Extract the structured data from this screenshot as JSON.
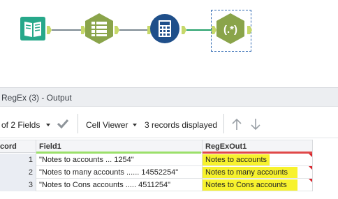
{
  "workflow": {
    "tools": [
      {
        "name": "input-data-tool",
        "icon": "book-icon"
      },
      {
        "name": "select-tool",
        "icon": "table-list-icon"
      },
      {
        "name": "formula-tool",
        "icon": "calculator-globe-icon"
      },
      {
        "name": "regex-tool",
        "icon": "regex-icon",
        "label": "(.*)"
      }
    ],
    "colors": {
      "connector": "#7c8a92",
      "active_connector": "#24a06a",
      "tool_green": "#8aa44a",
      "input_teal": "#27a88a",
      "formula_blue": "#1f4f8a"
    }
  },
  "panel": {
    "title": "RegEx (3) - Output"
  },
  "toolbar": {
    "fields_label": "of 2 Fields",
    "cell_viewer_label": "Cell Viewer",
    "records_label": "3 records displayed"
  },
  "grid": {
    "columns": [
      "cord",
      "Field1",
      "RegExOut1"
    ],
    "rows": [
      {
        "n": "1",
        "field1": "\"Notes to accounts ... 1254\"",
        "regex": "Notes to accounts"
      },
      {
        "n": "2",
        "field1": "\"Notes to many accounts ...... 14552254\"",
        "regex": "Notes to many accounts"
      },
      {
        "n": "3",
        "field1": "\"Notes to Cons accounts ..... 4511254\"",
        "regex": "Notes to Cons accounts"
      }
    ],
    "colors": {
      "highlight": "#f7f22e",
      "flag": "#d8232a",
      "field1_header": "#9be06a",
      "regex_header": "#e04848"
    }
  }
}
